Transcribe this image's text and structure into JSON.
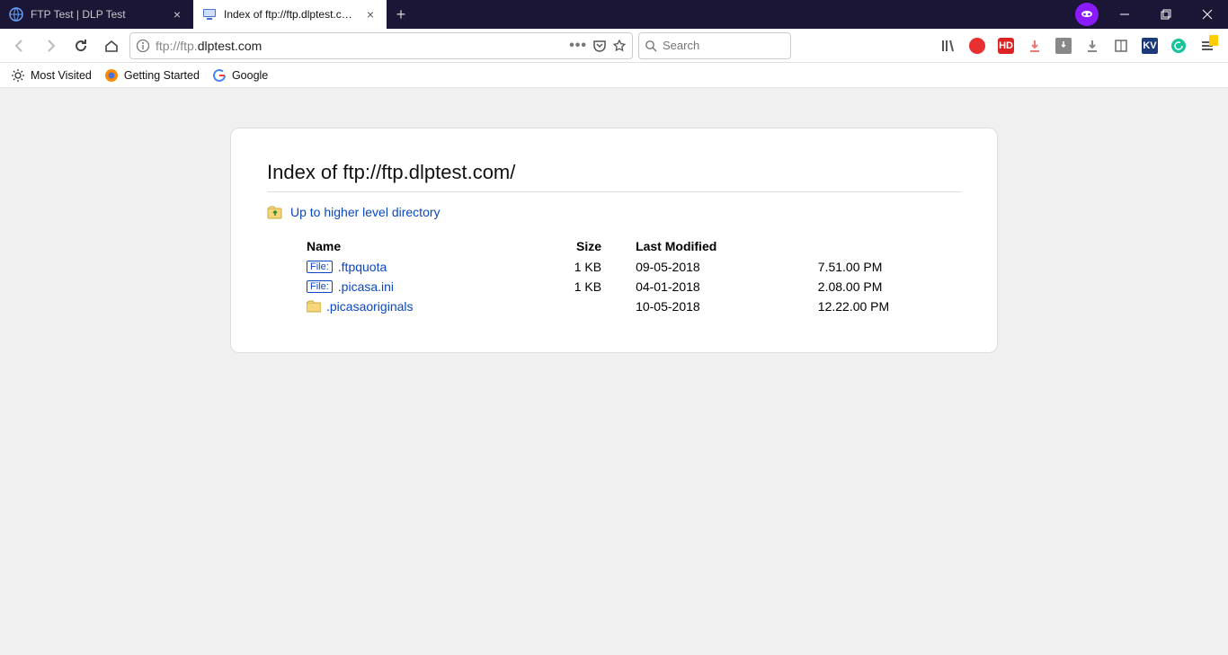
{
  "tabs": [
    {
      "title": "FTP Test | DLP Test",
      "active": false
    },
    {
      "title": "Index of ftp://ftp.dlptest.com/",
      "active": true
    }
  ],
  "url_prefix": "ftp://ftp.",
  "url_domain": "dlptest.com",
  "search_placeholder": "Search",
  "bookmarks": {
    "most_visited": "Most Visited",
    "getting_started": "Getting Started",
    "google": "Google"
  },
  "page": {
    "heading": "Index of ftp://ftp.dlptest.com/",
    "up_link": "Up to higher level directory",
    "columns": {
      "name": "Name",
      "size": "Size",
      "modified": "Last Modified"
    },
    "rows": [
      {
        "type": "file",
        "name": ".ftpquota",
        "size": "1 KB",
        "date": "09-05-2018",
        "time": "7.51.00 PM"
      },
      {
        "type": "file",
        "name": ".picasa.ini",
        "size": "1 KB",
        "date": "04-01-2018",
        "time": "2.08.00 PM"
      },
      {
        "type": "dir",
        "name": ".picasaoriginals",
        "size": "",
        "date": "10-05-2018",
        "time": "12.22.00 PM"
      }
    ]
  }
}
